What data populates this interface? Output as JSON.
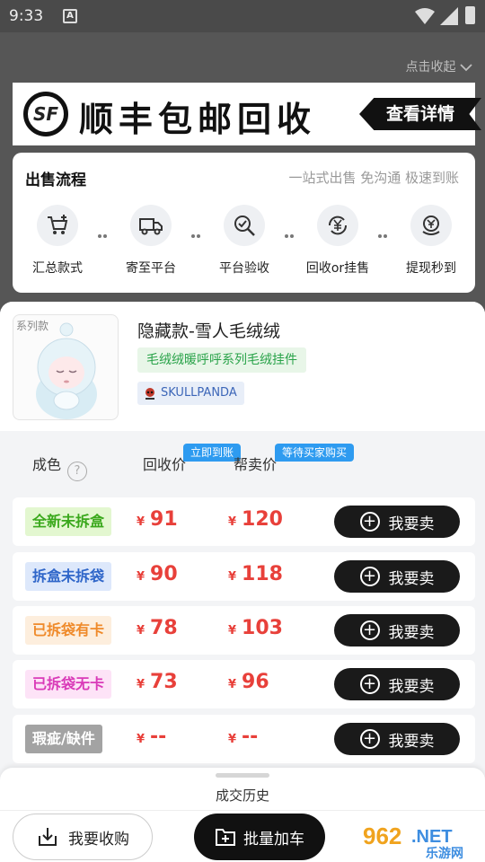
{
  "status_bar": {
    "time": "9:33",
    "notif_letter": "A"
  },
  "collapse_label": "点击收起",
  "banner": {
    "logo": "SF",
    "title": "顺丰包邮回收",
    "detail_label": "查看详情"
  },
  "process": {
    "title": "出售流程",
    "subtitle": "一站式出售 免沟通 极速到账",
    "steps": [
      {
        "label": "汇总款式",
        "icon": "cart-plus-icon"
      },
      {
        "label": "寄至平台",
        "icon": "truck-icon"
      },
      {
        "label": "平台验收",
        "icon": "magnify-check-icon"
      },
      {
        "label": "回收or挂售",
        "icon": "yen-cycle-icon"
      },
      {
        "label": "提现秒到",
        "icon": "yen-withdraw-icon"
      }
    ]
  },
  "product": {
    "image_tag": "系列款",
    "name": "隐藏款-雪人毛绒绒",
    "series": "毛绒绒暖呼呼系列毛绒挂件",
    "brand": "SKULLPANDA"
  },
  "table": {
    "col_condition": "成色",
    "col_recycle": "回收价",
    "col_consign": "帮卖价",
    "bubble_recycle": "立即到账",
    "bubble_consign": "等待买家购买",
    "currency": "¥",
    "sell_label": "我要卖",
    "rows": [
      {
        "condition": "全新未拆盒",
        "recycle": "91",
        "consign": "120",
        "bg": "#e3f7d0",
        "fg": "#3aa81c"
      },
      {
        "condition": "拆盒未拆袋",
        "recycle": "90",
        "consign": "118",
        "bg": "#dde8fb",
        "fg": "#2f66c9"
      },
      {
        "condition": "已拆袋有卡",
        "recycle": "78",
        "consign": "103",
        "bg": "#fdeedd",
        "fg": "#ef8a2a"
      },
      {
        "condition": "已拆袋无卡",
        "recycle": "73",
        "consign": "96",
        "bg": "#fde3f7",
        "fg": "#d93ab8"
      },
      {
        "condition": "瑕疵/缺件",
        "recycle": "--",
        "consign": "--",
        "bg": "#a3a3a3",
        "fg": "#ffffff"
      }
    ]
  },
  "bottom": {
    "history_label": "成交历史",
    "buy_label": "我要收购",
    "batch_label": "批量加车",
    "watermark_top": "962",
    "watermark_net": ".NET",
    "watermark_sub": "乐游网"
  }
}
